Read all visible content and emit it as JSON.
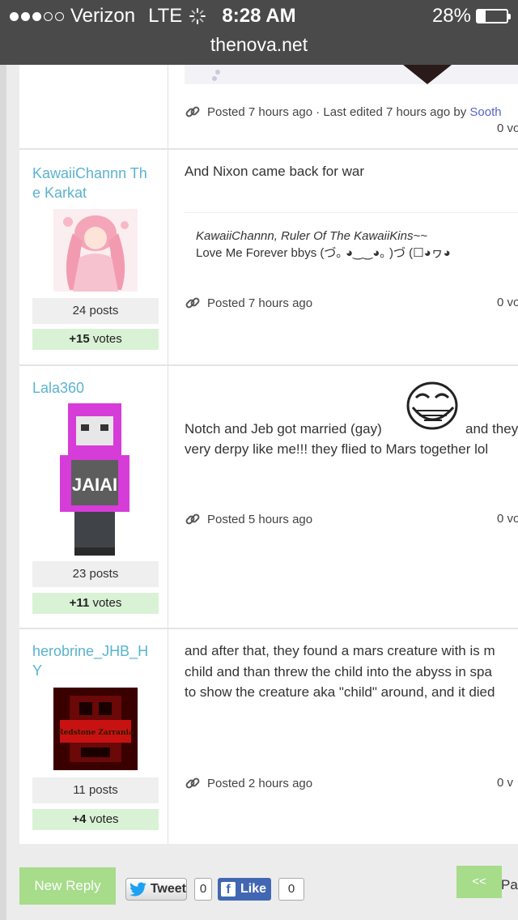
{
  "status_bar": {
    "carrier": "Verizon",
    "network": "LTE",
    "time": "8:28 AM",
    "battery": "28%",
    "battery_level": 0.28,
    "url": "thenova.net"
  },
  "posts": [
    {
      "meta_prefix": "Posted 7 hours ago · Last edited 7 hours ago by ",
      "author": "Sooth",
      "votes_count": "0",
      "votes_word": "vo"
    },
    {
      "username": "KawaiiChannn The Karkat",
      "posts": "24 posts",
      "votes_score": "+15",
      "votes_word": "votes",
      "body": "And Nixon came back for war",
      "signature_line1": "KawaiiChannn, Ruler Of The KawaiiKins~~",
      "signature_line2": "Love Me Forever bbys (づ｡ ◕‿‿◕｡ )づ (☐◕ヮ◕",
      "meta": "Posted 7 hours ago",
      "vote_count": "0",
      "vote_word": "vo"
    },
    {
      "username": "Lala360",
      "posts": "23 posts",
      "votes_score": "+11",
      "votes_word": "votes",
      "body_line1a": "Notch and Jeb got married (gay)",
      "body_line1b": "and they",
      "body_line2": "very derpy like me!!! they flied to Mars together lol",
      "meta": "Posted 5 hours ago",
      "vote_count": "0",
      "vote_word": "vo"
    },
    {
      "username": "herobrine_JHB_HY",
      "posts": "11 posts",
      "votes_score": "+4",
      "votes_word": "votes",
      "avatar_text": "Redstone Zarrania",
      "body_line1": "and after that, they found a mars creature with is m",
      "body_line2": "child and than threw the child into the abyss in spa",
      "body_line3": "to show the creature aka \"child\" around, and it died",
      "meta": "Posted 2 hours ago",
      "vote_count": "0",
      "vote_word": "v"
    }
  ],
  "footer": {
    "new_reply": "New Reply",
    "tweet": "Tweet",
    "tweet_count": "0",
    "like": "Like",
    "like_count": "0",
    "prev": "<<",
    "page_partial": "Pa"
  },
  "icons": [
    "link-icon",
    "twitter-bird-icon",
    "facebook-icon",
    "loading-spinner-icon",
    "battery-icon",
    "signal-dots-icon"
  ],
  "colors": {
    "username": "#5ab3cf",
    "votes_bg": "#d9f2d5",
    "button_green": "#a6dc8a",
    "facebook": "#4267b2",
    "author_link": "#5a62c9"
  }
}
